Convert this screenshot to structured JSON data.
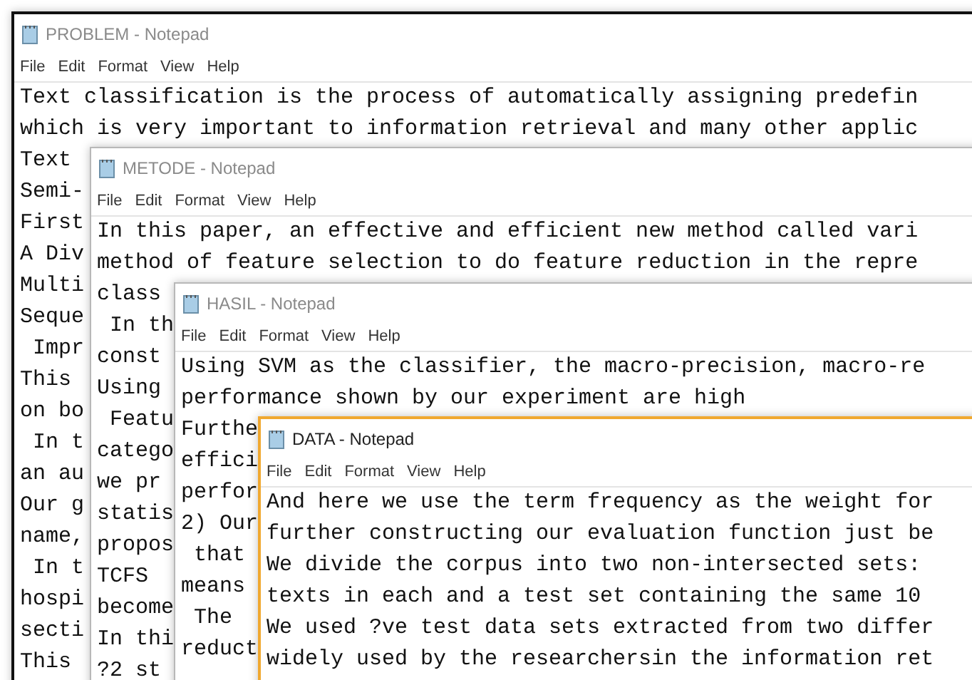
{
  "windows": [
    {
      "title": "PROBLEM - Notepad",
      "active": false,
      "menu": [
        "File",
        "Edit",
        "Format",
        "View",
        "Help"
      ],
      "lines": [
        "Text classification is the process of automatically assigning predefin",
        "which is very important to information retrieval and many other applic",
        "Text",
        "Semi-",
        "First",
        "A Div",
        "Multi",
        "Seque",
        " Impr",
        "This",
        "on bo",
        " In t",
        "an au",
        "Our g",
        "name,",
        " In t",
        "hospi",
        "secti",
        "This"
      ]
    },
    {
      "title": "METODE - Notepad",
      "active": false,
      "menu": [
        "File",
        "Edit",
        "Format",
        "View",
        "Help"
      ],
      "lines": [
        "In this paper, an effective and efficient new method called vari",
        "method of feature selection to do feature reduction in the repre",
        "class",
        " In th",
        "const",
        "Using",
        " Featu",
        "catego",
        "we pr",
        "statis",
        "propos",
        "TCFS",
        "become",
        "In thi",
        "?2 st"
      ]
    },
    {
      "title": "HASIL - Notepad",
      "active": false,
      "menu": [
        "File",
        "Edit",
        "Format",
        "View",
        "Help"
      ],
      "lines": [
        "Using SVM as the classifier, the macro-precision, macro-re",
        "performance shown by our experiment are high",
        "Furthe",
        "effici",
        "perfor",
        "2) Our",
        " that",
        "means",
        " The",
        "reduct"
      ]
    },
    {
      "title": "DATA - Notepad",
      "active": true,
      "menu": [
        "File",
        "Edit",
        "Format",
        "View",
        "Help"
      ],
      "lines": [
        "And here we use the term frequency as the weight for",
        "further constructing our evaluation function just be",
        "We divide the corpus into two non-intersected sets:",
        "texts in each and a test set containing the same 10",
        "We used ?ve test data sets extracted from two differ",
        "widely used by the researchersin the information ret"
      ]
    }
  ]
}
